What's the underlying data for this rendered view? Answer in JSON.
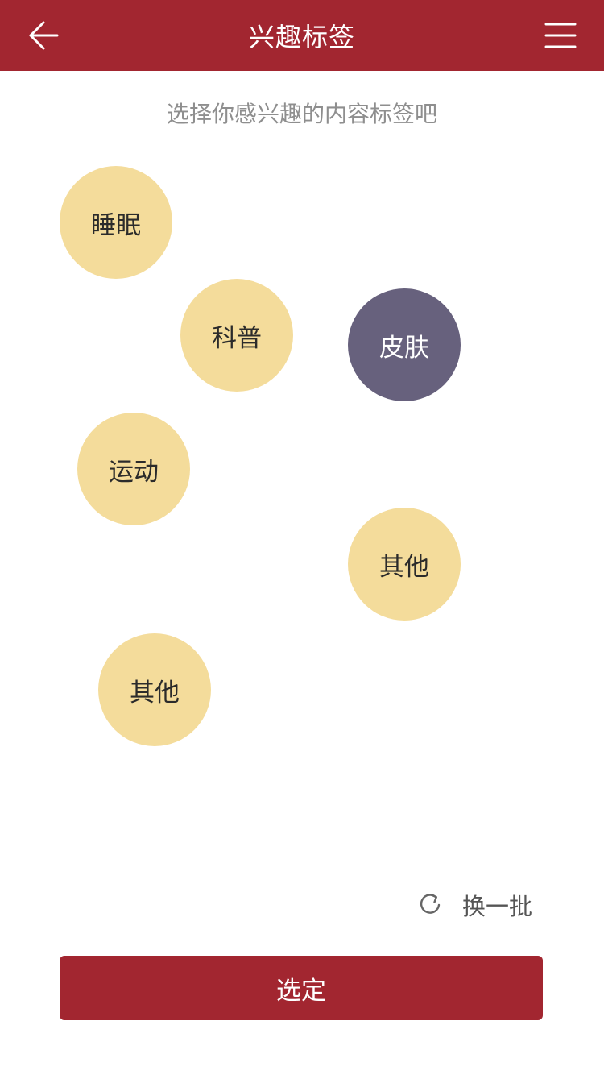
{
  "header": {
    "title": "兴趣标签",
    "back_icon": "arrow-left-icon",
    "menu_icon": "hamburger-menu-icon",
    "color": "#a22630"
  },
  "subtitle": "选择你感兴趣的内容标签吧",
  "tags": [
    {
      "label": "睡眠",
      "selected": false
    },
    {
      "label": "科普",
      "selected": false
    },
    {
      "label": "皮肤",
      "selected": true
    },
    {
      "label": "运动",
      "selected": false
    },
    {
      "label": "其他",
      "selected": false
    },
    {
      "label": "其他",
      "selected": false
    }
  ],
  "tag_colors": {
    "default": "#f4dc9b",
    "selected": "#67617d"
  },
  "refresh": {
    "icon": "refresh-icon",
    "label": "换一批"
  },
  "confirm_button": {
    "label": "选定",
    "color": "#a22630"
  }
}
